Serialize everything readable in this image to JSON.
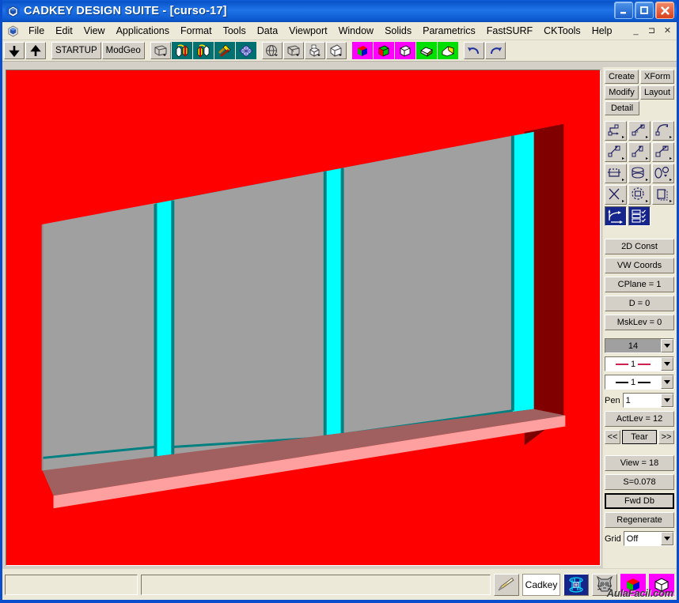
{
  "window": {
    "title": "CADKEY DESIGN SUITE - [curso-17]",
    "app_icon": "cadkey-logo-icon",
    "controls": [
      {
        "name": "minimize-button",
        "label": "_"
      },
      {
        "name": "maximize-button",
        "label": "□"
      },
      {
        "name": "close-button",
        "label": "✕"
      }
    ]
  },
  "menubar": {
    "doc_icon": "document-control-icon",
    "items": [
      "File",
      "Edit",
      "View",
      "Applications",
      "Format",
      "Tools",
      "Data",
      "Viewport",
      "Window",
      "Solids",
      "Parametrics",
      "FastSURF",
      "CKTools",
      "Help"
    ],
    "mdi_controls": [
      "_",
      "⊐",
      "✕"
    ]
  },
  "toolbar": {
    "buttons": [
      {
        "name": "level-down-button",
        "kind": "arrow-down",
        "label": ""
      },
      {
        "name": "level-up-button",
        "kind": "arrow-up",
        "label": ""
      },
      {
        "name": "startup-button",
        "kind": "text",
        "label": "STARTUP"
      },
      {
        "name": "modgeo-button",
        "kind": "text",
        "label": "ModGeo"
      },
      {
        "name": "wireframe-view-button",
        "kind": "icon-gray",
        "label": ""
      },
      {
        "name": "solids-add-button",
        "kind": "icon-teal",
        "label": ""
      },
      {
        "name": "solids-subtract-button",
        "kind": "icon-teal",
        "label": ""
      },
      {
        "name": "solids-tools-button",
        "kind": "icon-teal",
        "label": ""
      },
      {
        "name": "mesh-button",
        "kind": "icon-teal",
        "label": ""
      },
      {
        "name": "rotate-view-button",
        "kind": "icon-gray",
        "label": ""
      },
      {
        "name": "box-view-button",
        "kind": "icon-gray",
        "label": ""
      },
      {
        "name": "extrude-button",
        "kind": "icon-gray",
        "label": ""
      },
      {
        "name": "shade-view-button",
        "kind": "icon-gray",
        "label": ""
      },
      {
        "name": "render-rgb-button",
        "kind": "icon-magenta",
        "label": ""
      },
      {
        "name": "render-wire-button",
        "kind": "icon-magenta",
        "label": ""
      },
      {
        "name": "render-hidden-button",
        "kind": "icon-magenta",
        "label": ""
      },
      {
        "name": "surface-green-button",
        "kind": "icon-green",
        "label": ""
      },
      {
        "name": "surface-yellow-button",
        "kind": "icon-green",
        "label": ""
      },
      {
        "name": "undo-button",
        "kind": "icon-undo",
        "label": ""
      },
      {
        "name": "redo-button",
        "kind": "icon-redo",
        "label": ""
      }
    ]
  },
  "right_panel": {
    "mode_buttons": [
      {
        "name": "create-button",
        "label": "Create"
      },
      {
        "name": "xform-button",
        "label": "XForm"
      },
      {
        "name": "modify-button",
        "label": "Modify"
      },
      {
        "name": "layout-button",
        "label": "Layout"
      },
      {
        "name": "detail-button",
        "label": "Detail"
      }
    ],
    "tool_icons": [
      {
        "name": "point-tool-button",
        "selected": false
      },
      {
        "name": "line-tool-button",
        "selected": false
      },
      {
        "name": "arc-tool-button",
        "selected": false
      },
      {
        "name": "polyline-tool-button",
        "selected": false
      },
      {
        "name": "spline-tool-button",
        "selected": false
      },
      {
        "name": "rectangle-tool-button",
        "selected": false
      },
      {
        "name": "fillet-tool-button",
        "selected": false
      },
      {
        "name": "ellipse-tool-button",
        "selected": false
      },
      {
        "name": "conic-tool-button",
        "selected": false
      },
      {
        "name": "cross-tool-button",
        "selected": false
      },
      {
        "name": "polygon-tool-button",
        "selected": false
      },
      {
        "name": "copy-tool-button",
        "selected": false
      },
      {
        "name": "curve-tool-button",
        "selected": true
      },
      {
        "name": "list-tool-button",
        "selected": true
      }
    ],
    "status_buttons": [
      {
        "name": "construction-mode-button",
        "label": "2D Const"
      },
      {
        "name": "view-coords-button",
        "label": "VW Coords"
      },
      {
        "name": "cplane-button",
        "label": "CPlane = 1"
      },
      {
        "name": "depth-button",
        "label": "D = 0"
      },
      {
        "name": "mask-level-button",
        "label": "MskLev = 0"
      }
    ],
    "color_select": {
      "name": "color-select",
      "value": "14",
      "swatch": "#a0a0a0"
    },
    "linestyle_select": {
      "name": "line-style-select",
      "value": "1",
      "color": "#d02050"
    },
    "linewidth_select": {
      "name": "line-width-select",
      "value": "1",
      "color": "#000000"
    },
    "pen": {
      "name": "pen-select",
      "label": "Pen",
      "value": "1"
    },
    "active_level": {
      "name": "active-level-button",
      "label": "ActLev = 12"
    },
    "tear_row": {
      "prev": "<<",
      "label": "Tear",
      "next": ">>"
    },
    "view_buttons": [
      {
        "name": "view-number-button",
        "label": "View = 18",
        "strong": false
      },
      {
        "name": "scale-button",
        "label": "S=0.078",
        "strong": false
      },
      {
        "name": "forward-database-button",
        "label": "Fwd Db",
        "strong": true
      },
      {
        "name": "regenerate-button",
        "label": "Regenerate",
        "strong": false
      }
    ],
    "grid": {
      "name": "grid-select",
      "label": "Grid",
      "value": "Off"
    }
  },
  "statusbar": {
    "prompt_field": {
      "name": "status-prompt-field",
      "value": ""
    },
    "main_field": {
      "name": "status-message-field",
      "value": ""
    },
    "buttons": [
      {
        "name": "pencil-tool-button",
        "label": ""
      },
      {
        "name": "cadkey-logo-button",
        "label": "Cadkey"
      },
      {
        "name": "dynamic-rotate-button",
        "label": ""
      },
      {
        "name": "cat-mascot-button",
        "label": ""
      },
      {
        "name": "shade-cube-button",
        "label": ""
      },
      {
        "name": "wireframe-cube-button",
        "label": ""
      }
    ],
    "watermark": "AulaFacil.com"
  },
  "viewport": {
    "name": "cad-drawing-viewport",
    "background_color": "#ff0000",
    "model": "3d-window-frame-with-three-glass-panes",
    "colors": {
      "background": "#ff0000",
      "glass": "#a0a0a0",
      "frame": "#00ffff",
      "frame_shadow": "#008080",
      "jamb_dark": "#800000",
      "sill_top": "#a06060",
      "sill_edge": "#ffa0a0"
    }
  }
}
